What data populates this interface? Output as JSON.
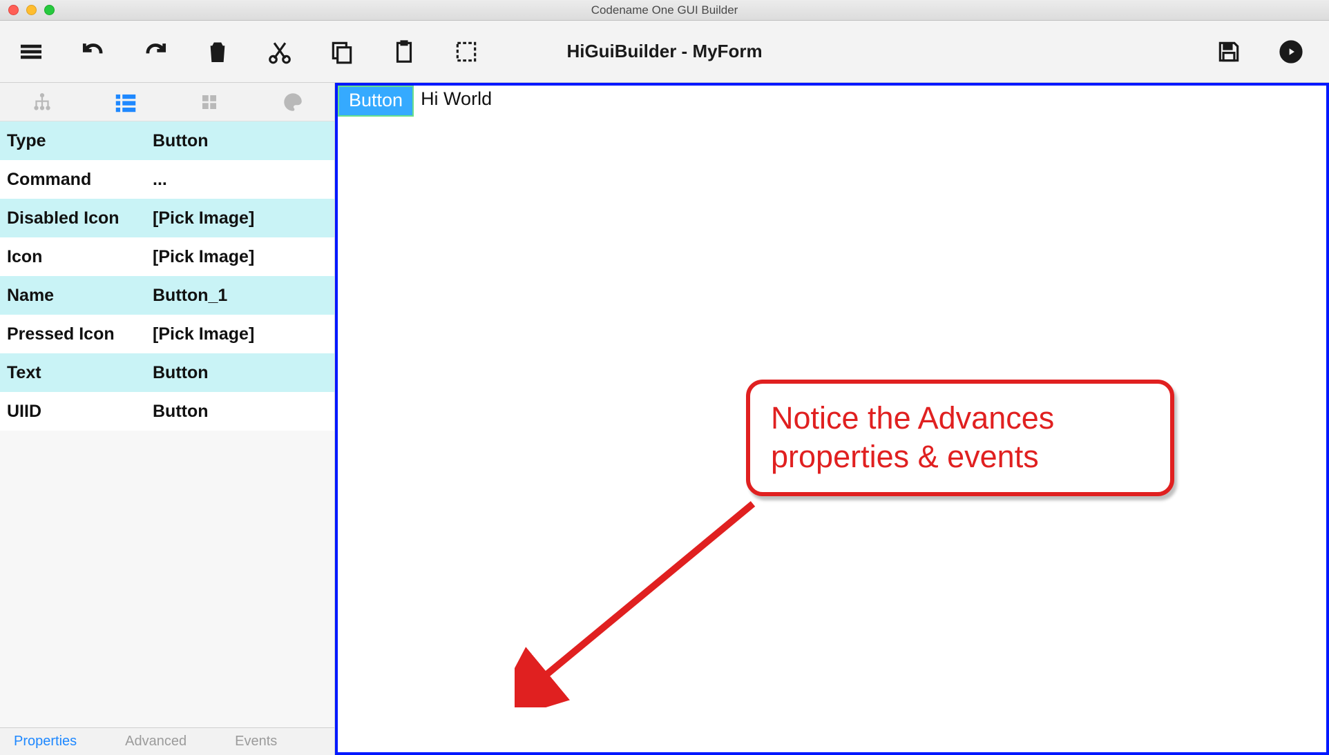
{
  "window": {
    "title": "Codename One GUI Builder"
  },
  "toolbar": {
    "form_name": "HiGuiBuilder - MyForm"
  },
  "properties": [
    {
      "key": "Type",
      "value": "Button"
    },
    {
      "key": "Command",
      "value": "..."
    },
    {
      "key": "Disabled Icon",
      "value": "[Pick Image]"
    },
    {
      "key": "Icon",
      "value": "[Pick Image]"
    },
    {
      "key": "Name",
      "value": "Button_1"
    },
    {
      "key": "Pressed Icon",
      "value": "[Pick Image]"
    },
    {
      "key": "Text",
      "value": "Button"
    },
    {
      "key": "UIID",
      "value": "Button"
    }
  ],
  "bottom_tabs": {
    "properties": "Properties",
    "advanced": "Advanced",
    "events": "Events"
  },
  "canvas": {
    "button_text": "Button",
    "label_text": "Hi World"
  },
  "annotation": {
    "line1": "Notice the Advances",
    "line2": "properties & events"
  }
}
